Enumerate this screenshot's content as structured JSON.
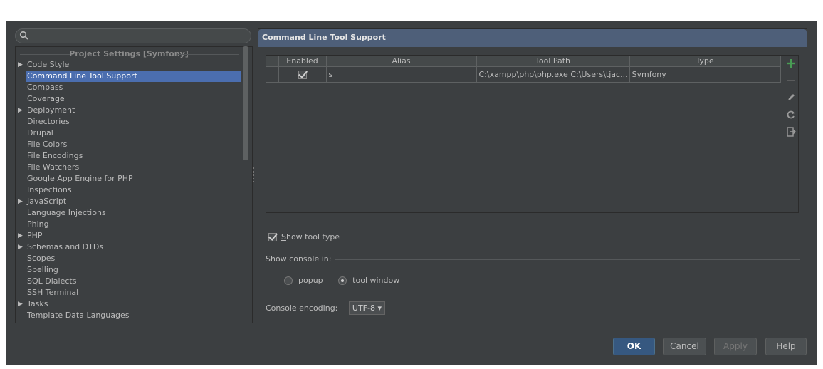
{
  "search": {
    "placeholder": ""
  },
  "tree": {
    "header": "Project Settings [Symfony]",
    "items": [
      {
        "label": "Code Style",
        "expandable": true
      },
      {
        "label": "Command Line Tool Support",
        "expandable": false,
        "selected": true
      },
      {
        "label": "Compass",
        "expandable": false
      },
      {
        "label": "Coverage",
        "expandable": false
      },
      {
        "label": "Deployment",
        "expandable": true
      },
      {
        "label": "Directories",
        "expandable": false
      },
      {
        "label": "Drupal",
        "expandable": false
      },
      {
        "label": "File Colors",
        "expandable": false
      },
      {
        "label": "File Encodings",
        "expandable": false
      },
      {
        "label": "File Watchers",
        "expandable": false
      },
      {
        "label": "Google App Engine for PHP",
        "expandable": false
      },
      {
        "label": "Inspections",
        "expandable": false
      },
      {
        "label": "JavaScript",
        "expandable": true
      },
      {
        "label": "Language Injections",
        "expandable": false
      },
      {
        "label": "Phing",
        "expandable": false
      },
      {
        "label": "PHP",
        "expandable": true
      },
      {
        "label": "Schemas and DTDs",
        "expandable": true
      },
      {
        "label": "Scopes",
        "expandable": false
      },
      {
        "label": "Spelling",
        "expandable": false
      },
      {
        "label": "SQL Dialects",
        "expandable": false
      },
      {
        "label": "SSH Terminal",
        "expandable": false
      },
      {
        "label": "Tasks",
        "expandable": true
      },
      {
        "label": "Template Data Languages",
        "expandable": false
      }
    ]
  },
  "panel": {
    "title": "Command Line Tool Support",
    "table": {
      "columns": [
        "Enabled",
        "Alias",
        "Tool Path",
        "Type"
      ],
      "rows": [
        {
          "enabled": true,
          "alias": "s",
          "tool_path": "C:\\xampp\\php\\php.exe C:\\Users\\tjac...",
          "type": "Symfony"
        }
      ]
    },
    "toolbar_icons": [
      "add-icon",
      "remove-icon",
      "edit-icon",
      "refresh-icon",
      "export-icon"
    ],
    "show_tool_type": {
      "label": "Show tool type",
      "checked": true
    },
    "show_console_in": {
      "label": "Show console in:",
      "options": [
        {
          "label": "popup",
          "selected": false
        },
        {
          "label": "tool window",
          "selected": true
        }
      ]
    },
    "console_encoding": {
      "label": "Console encoding:",
      "value": "UTF-8"
    }
  },
  "buttons": {
    "ok": "OK",
    "cancel": "Cancel",
    "apply": "Apply",
    "help": "Help"
  },
  "colors": {
    "background": "#3c3f41",
    "selection": "#4b6eaf",
    "title_bar": "#4e5f79",
    "add_green": "#499c54"
  }
}
